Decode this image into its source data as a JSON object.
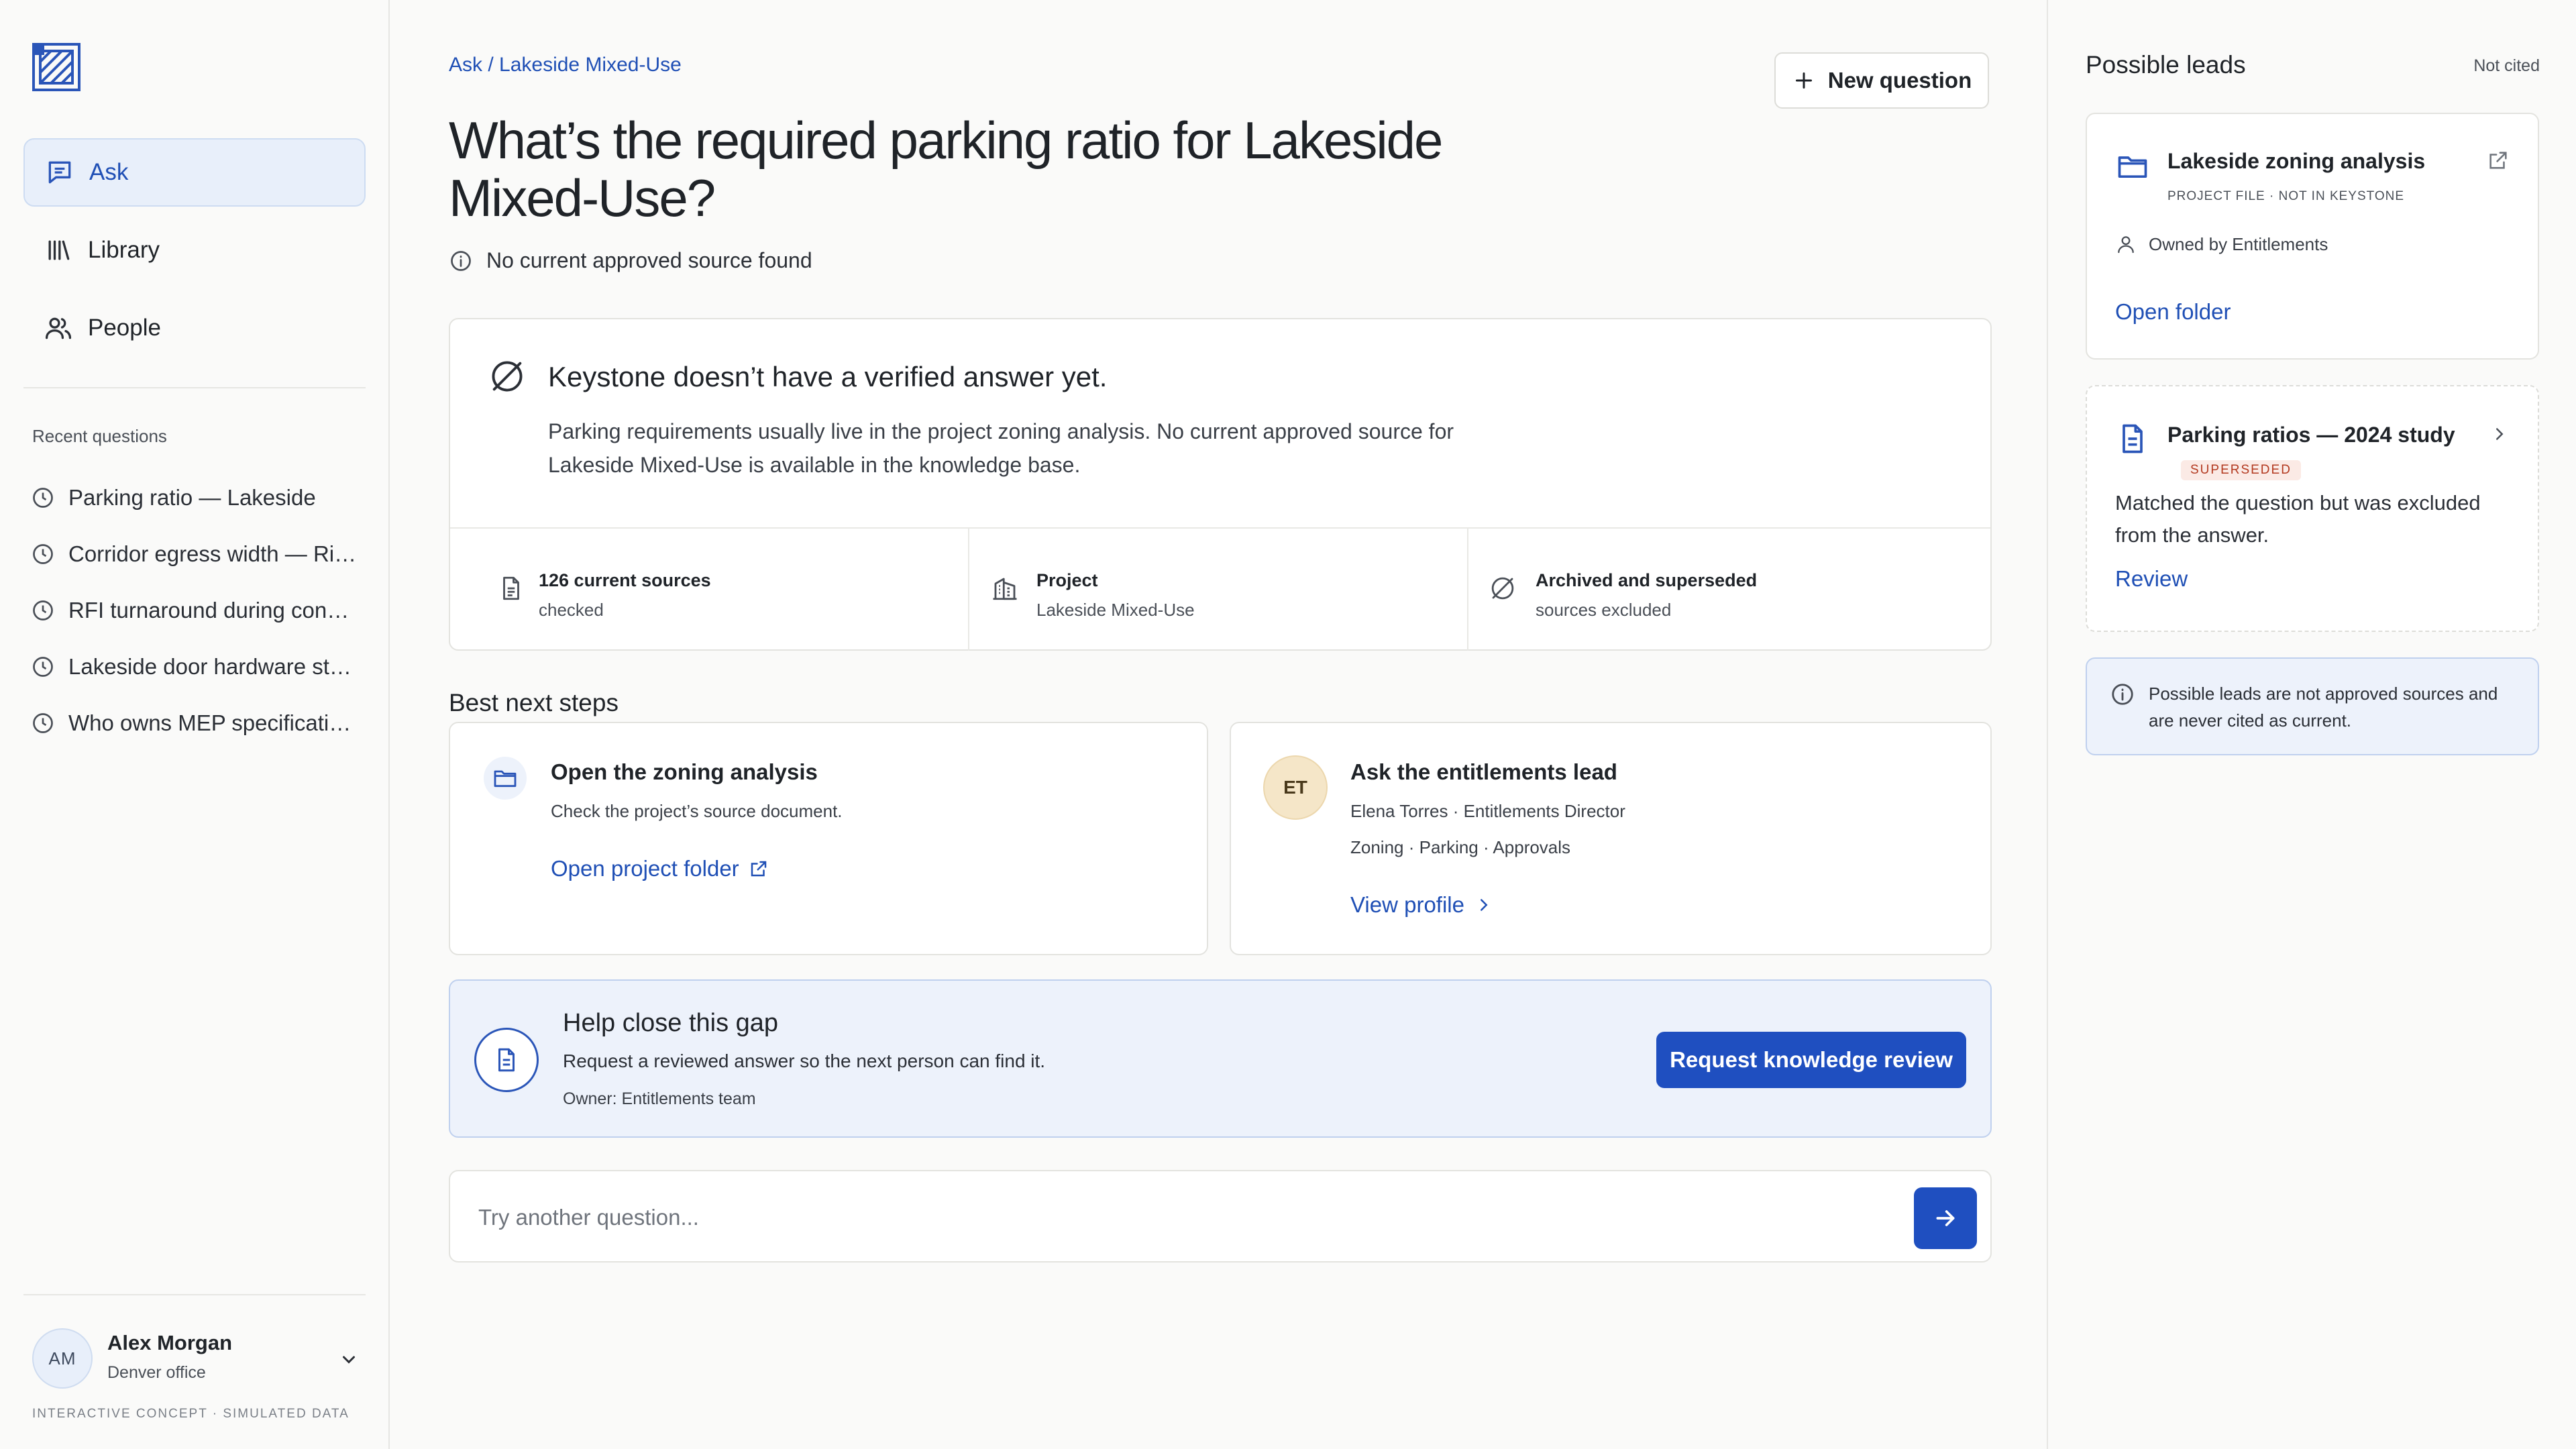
{
  "sidebar": {
    "nav": [
      {
        "label": "Ask",
        "icon": "chat-icon",
        "active": true
      },
      {
        "label": "Library",
        "icon": "library-icon",
        "active": false
      },
      {
        "label": "People",
        "icon": "people-icon",
        "active": false
      }
    ],
    "recent_title": "Recent questions",
    "recent": [
      "Parking ratio — Lakeside",
      "Corridor egress width — Riv…",
      "RFI turnaround during const…",
      "Lakeside door hardware sta…",
      "Who owns MEP specificatio…"
    ],
    "user": {
      "initials": "AM",
      "name": "Alex Morgan",
      "office": "Denver office"
    },
    "footnote": "INTERACTIVE CONCEPT · SIMULATED DATA"
  },
  "main": {
    "breadcrumb": "Ask / Lakeside Mixed-Use",
    "new_question": "New question",
    "title": "What’s the required parking ratio for Lakeside Mixed-Use?",
    "status": "No current approved source found",
    "answer": {
      "title": "Keystone doesn’t have a verified answer yet.",
      "body": "Parking requirements usually live in the project zoning analysis. No current approved source for Lakeside Mixed-Use is available in the knowledge base.",
      "stats": [
        {
          "title": "126 current sources",
          "sub": "checked"
        },
        {
          "title": "Project",
          "sub": "Lakeside Mixed-Use"
        },
        {
          "title": "Archived and superseded",
          "sub": "sources excluded"
        }
      ]
    },
    "next_steps_title": "Best next steps",
    "steps": [
      {
        "title": "Open the zoning analysis",
        "sub": "Check the project’s source document.",
        "link": "Open project folder"
      },
      {
        "initials": "ET",
        "title": "Ask the entitlements lead",
        "sub": "Elena Torres · Entitlements Director",
        "tags": "Zoning · Parking · Approvals",
        "link": "View profile"
      }
    ],
    "gap": {
      "title": "Help close this gap",
      "sub": "Request a reviewed answer so the next person can find it.",
      "owner": "Owner: Entitlements team",
      "button": "Request knowledge review"
    },
    "ask_placeholder": "Try another question..."
  },
  "right": {
    "title": "Possible leads",
    "not_cited": "Not cited",
    "leads": [
      {
        "title": "Lakeside zoning analysis",
        "meta": "PROJECT FILE · NOT IN KEYSTONE",
        "owner": "Owned by Entitlements",
        "link": "Open folder"
      },
      {
        "title": "Parking ratios — 2024 study",
        "badge": "SUPERSEDED",
        "desc": "Matched the question but was excluded from the answer.",
        "link": "Review"
      }
    ],
    "note": "Possible leads are not approved sources and are never cited as current."
  },
  "colors": {
    "accent": "#1f4fc0",
    "link": "#1f4fb5",
    "badge_bg": "#fbeae5",
    "badge_text": "#b3391f"
  }
}
